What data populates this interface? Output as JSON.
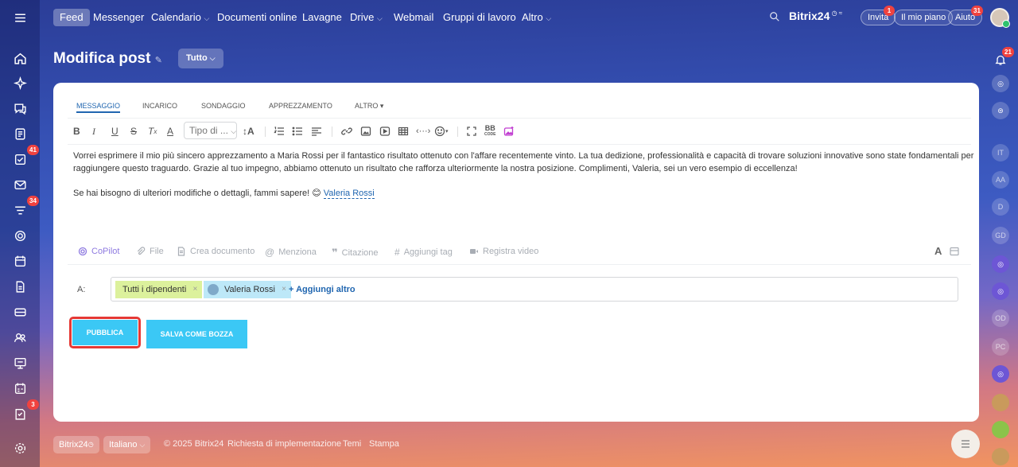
{
  "topnav": {
    "items": [
      "Feed",
      "Messenger",
      "Calendario",
      "Documenti online",
      "Lavagne",
      "Drive",
      "Webmail",
      "Gruppi di lavoro",
      "Altro"
    ],
    "brand": "Bitrix24",
    "invite": "Invita",
    "invite_badge": "1",
    "plan": "Il mio piano",
    "help": "Aiuto",
    "help_badge": "31"
  },
  "sidebar": {
    "badges": {
      "tasks": "41",
      "feed": "34",
      "workflows": "3"
    }
  },
  "header": {
    "title": "Modifica post",
    "filter": "Tutto"
  },
  "editor": {
    "tabs": [
      "MESSAGGIO",
      "INCARICO",
      "SONDAGGIO",
      "APPREZZAMENTO",
      "ALTRO"
    ],
    "font_select": "Tipo di ...",
    "body": {
      "line1": "Vorrei esprimere il mio più sincero apprezzamento a Maria Rossi per il fantastico risultato ottenuto con l'affare recentemente vinto. La tua dedizione, professionalità e capacità di trovare soluzioni innovative sono state fondamentali per",
      "line2": "raggiungere questo traguardo. Grazie al tuo impegno, abbiamo ottenuto un risultato che rafforza ulteriormente la nostra posizione. Complimenti, Valeria, sei un vero esempio di eccellenza!",
      "line3": "Se hai bisogno di ulteriori modifiche o dettagli, fammi sapere!",
      "mention": "Valeria Rossi"
    },
    "actions": [
      "CoPilot",
      "File",
      "Crea documento",
      "Menziona",
      "Citazione",
      "Aggiungi tag",
      "Registra video"
    ],
    "recipients_label": "A:",
    "recipients": [
      "Tutti i dipendenti",
      "Valeria Rossi"
    ],
    "add_more": "+ Aggiungi altro",
    "publish": "PUBBLICA",
    "save_draft": "SALVA COME BOZZA"
  },
  "right_panel": {
    "notifications_badge": "21",
    "initials": [
      "IT",
      "AA",
      "D",
      "GD",
      "OD",
      "PC"
    ]
  },
  "footer": {
    "brand": "Bitrix24",
    "language": "Italiano",
    "copyright": "© 2025 Bitrix24",
    "links": [
      "Richiesta di implementazione",
      "Temi",
      "Stampa"
    ]
  },
  "colors": {
    "accent": "#3bc8f5",
    "highlight_border": "#e53935",
    "tag_all": "#dcf19c",
    "tag_user": "#bde8f8",
    "link": "#2066b0"
  }
}
